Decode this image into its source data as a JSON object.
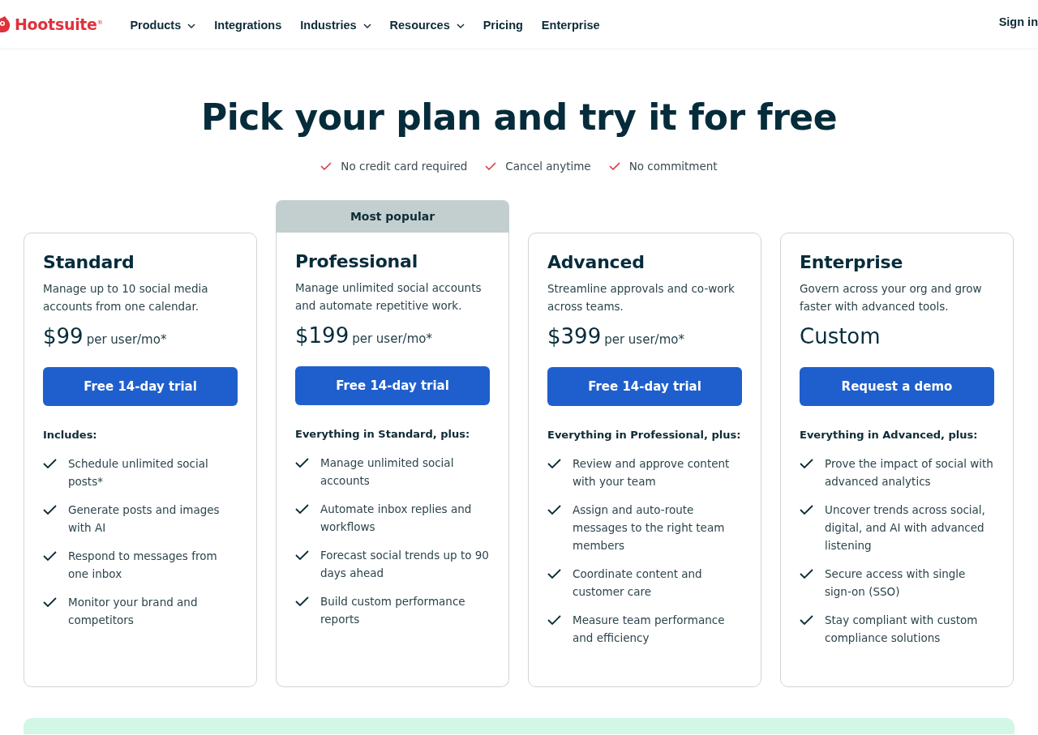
{
  "nav": {
    "logo": "Hootsuite$^{®}$",
    "items": [
      {
        "label": "Products",
        "dropdown": true
      },
      {
        "label": "Integrations",
        "dropdown": false
      },
      {
        "label": "Industries",
        "dropdown": true
      },
      {
        "label": "Resources",
        "dropdown": true
      },
      {
        "label": "Pricing",
        "dropdown": false
      },
      {
        "label": "Enterprise",
        "dropdown": false
      }
    ],
    "sign_in": "Sign in"
  },
  "hero": {
    "title": "Pick your plan and try it for free",
    "perks": [
      "No credit card required",
      "Cancel anytime",
      "No commitment"
    ]
  },
  "plans": [
    {
      "name": "Standard",
      "description": "Manage up to 10 social media accounts from one calendar.",
      "price": "$99",
      "price_note": "per user/mo*",
      "button": "Free 14-day trial",
      "features_heading": "Includes:",
      "features": [
        "Schedule unlimited social posts*",
        "Generate posts and images with AI",
        "Respond to messages from one inbox",
        "Monitor your brand and competitors"
      ]
    },
    {
      "name": "Professional",
      "badge": "Most popular",
      "description": "Manage unlimited social accounts and automate repetitive work.",
      "price": "$199",
      "price_note": "per user/mo*",
      "button": "Free 14-day trial",
      "features_heading": "Everything in Standard, plus:",
      "features": [
        "Manage unlimited social accounts",
        "Automate inbox replies and workflows",
        "Forecast social trends up to 90 days ahead",
        "Build custom performance reports"
      ]
    },
    {
      "name": "Advanced",
      "description": "Streamline approvals and co-work across teams.",
      "price": "$399",
      "price_note": "per user/mo*",
      "button": "Free 14-day trial",
      "features_heading": "Everything in Professional, plus:",
      "features": [
        "Review and approve content with your team",
        "Assign and auto-route messages to the right team members",
        "Coordinate content and customer care",
        "Measure team performance and efficiency"
      ]
    },
    {
      "name": "Enterprise",
      "description": "Govern across your org and grow faster with advanced tools.",
      "price": "Custom",
      "button": "Request a demo",
      "features_heading": "Everything in Advanced, plus:",
      "features": [
        "Prove the impact of social with advanced analytics",
        "Uncover trends across social, digital, and AI with advanced listening",
        "Secure access with single sign-on (SSO)",
        "Stay compliant with custom compliance solutions"
      ]
    }
  ]
}
